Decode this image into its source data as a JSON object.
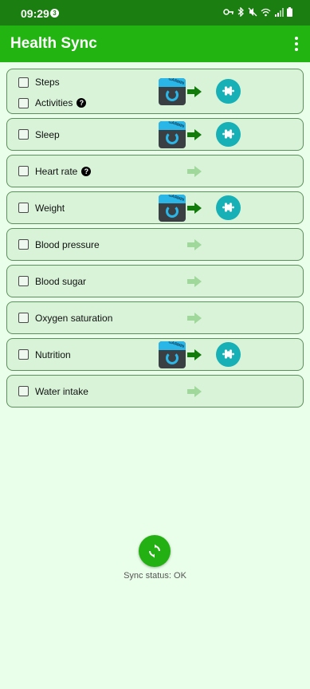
{
  "status_bar": {
    "time": "09:29",
    "notification_count": "3"
  },
  "app": {
    "title": "Health Sync"
  },
  "rows": [
    {
      "items": [
        {
          "label": "Steps"
        },
        {
          "label": "Activities",
          "help": "?"
        }
      ],
      "synced": true
    },
    {
      "items": [
        {
          "label": "Sleep"
        }
      ],
      "synced": true
    },
    {
      "items": [
        {
          "label": "Heart rate",
          "help": "?"
        }
      ],
      "synced": false
    },
    {
      "items": [
        {
          "label": "Weight"
        }
      ],
      "synced": true
    },
    {
      "items": [
        {
          "label": "Blood pressure"
        }
      ],
      "synced": false
    },
    {
      "items": [
        {
          "label": "Blood sugar"
        }
      ],
      "synced": false
    },
    {
      "items": [
        {
          "label": "Oxygen saturation"
        }
      ],
      "synced": false
    },
    {
      "items": [
        {
          "label": "Nutrition"
        }
      ],
      "synced": true
    },
    {
      "items": [
        {
          "label": "Water intake"
        }
      ],
      "synced": false
    }
  ],
  "source_app": {
    "icon": "garmin-connect-icon",
    "text": "GARMIN"
  },
  "destination_app": {
    "icon": "fitbit-icon"
  },
  "colors": {
    "active_arrow": "#137a0c",
    "inactive_arrow": "#9fd89a"
  },
  "sync": {
    "status_text": "Sync status: OK"
  }
}
